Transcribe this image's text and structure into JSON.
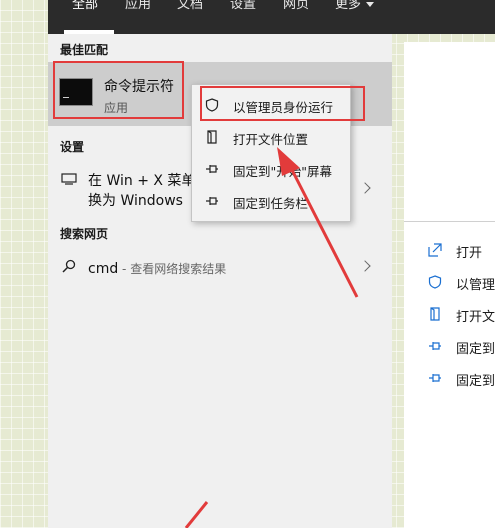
{
  "tabs": [
    {
      "label": "全部",
      "active": true
    },
    {
      "label": "应用",
      "active": false
    },
    {
      "label": "文档",
      "active": false
    },
    {
      "label": "设置",
      "active": false
    },
    {
      "label": "网页",
      "active": false
    },
    {
      "label": "更多",
      "active": false
    }
  ],
  "sections": {
    "best_match": "最佳匹配",
    "settings": "设置",
    "web": "搜索网页"
  },
  "best_match": {
    "title": "命令提示符",
    "subtitle": "应用"
  },
  "settings_item": {
    "line1": "在 Win + X 菜单",
    "line2": "换为 Windows"
  },
  "web_item": {
    "query": "cmd",
    "hint": " - 查看网络搜索结果"
  },
  "context_menu": [
    {
      "label": "以管理员身份运行",
      "icon": "shield-icon"
    },
    {
      "label": "打开文件位置",
      "icon": "file-icon"
    },
    {
      "label": "固定到\"开始\"屏幕",
      "icon": "pin-icon"
    },
    {
      "label": "固定到任务栏",
      "icon": "pin-icon"
    }
  ],
  "right_actions": [
    {
      "label": "打开",
      "icon": "open-icon"
    },
    {
      "label": "以管理",
      "icon": "shield-icon"
    },
    {
      "label": "打开文",
      "icon": "file-icon"
    },
    {
      "label": "固定到",
      "icon": "pin-icon"
    },
    {
      "label": "固定到",
      "icon": "pin-icon"
    }
  ],
  "colors": {
    "annotation": "#e23b3b",
    "accent": "#1a6fd1",
    "tabbar": "#2b2b2b"
  }
}
